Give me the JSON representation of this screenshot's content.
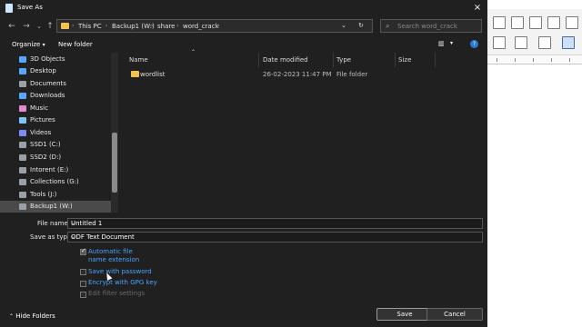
{
  "dialog": {
    "title": "Save As",
    "close_icon": "×"
  },
  "address": {
    "crumbs": [
      "This PC",
      "Backup1 (W:)",
      "share",
      "word_crack"
    ],
    "refresh_icon": "↻",
    "dropdown_icon": "⌄"
  },
  "search": {
    "placeholder": "Search word_crack",
    "icon": "⌕"
  },
  "toolbar": {
    "organize": "Organize",
    "new_folder": "New folder"
  },
  "sidebar": {
    "items": [
      {
        "label": "3D Objects",
        "icon": "3d-objects-icon",
        "color": "#58a6ff"
      },
      {
        "label": "Desktop",
        "icon": "desktop-icon",
        "color": "#58a6ff"
      },
      {
        "label": "Documents",
        "icon": "documents-icon",
        "color": "#9aa0a6"
      },
      {
        "label": "Downloads",
        "icon": "downloads-icon",
        "color": "#58a6ff"
      },
      {
        "label": "Music",
        "icon": "music-icon",
        "color": "#e08ad0"
      },
      {
        "label": "Pictures",
        "icon": "pictures-icon",
        "color": "#7fc4f5"
      },
      {
        "label": "Videos",
        "icon": "videos-icon",
        "color": "#7f8bf5"
      },
      {
        "label": "SSD1 (C:)",
        "icon": "drive-icon",
        "color": "#9aa0a6"
      },
      {
        "label": "SSD2 (D:)",
        "icon": "drive-icon",
        "color": "#9aa0a6"
      },
      {
        "label": "Intorent (E:)",
        "icon": "drive-icon",
        "color": "#9aa0a6"
      },
      {
        "label": "Collections (G:)",
        "icon": "drive-icon",
        "color": "#9aa0a6"
      },
      {
        "label": "Tools (J:)",
        "icon": "drive-icon",
        "color": "#9aa0a6"
      },
      {
        "label": "Backup1 (W:)",
        "icon": "drive-icon",
        "color": "#9aa0a6"
      }
    ]
  },
  "columns": [
    "Name",
    "Date modified",
    "Type",
    "Size"
  ],
  "files": [
    {
      "name": "wordlist",
      "date": "26-02-2023 11:47 PM",
      "type": "File folder",
      "size": ""
    }
  ],
  "form": {
    "file_name_label": "File name:",
    "file_name_value": "Untitled 1",
    "save_type_label": "Save as type:",
    "save_type_value": "ODF Text Document",
    "options": [
      {
        "label": "Automatic file name extension",
        "checked": true,
        "enabled": true
      },
      {
        "label": "Save with password",
        "checked": false,
        "enabled": true
      },
      {
        "label": "Encrypt with GPG key",
        "checked": false,
        "enabled": true
      },
      {
        "label": "Edit filter settings",
        "checked": false,
        "enabled": false
      }
    ]
  },
  "footer": {
    "hide_folders": "Hide Folders",
    "save": "Save",
    "cancel": "Cancel"
  },
  "colors": {
    "dialog_bg": "#202020",
    "link_blue": "#4ba3ff",
    "folder_yellow": "#f2c14e"
  }
}
